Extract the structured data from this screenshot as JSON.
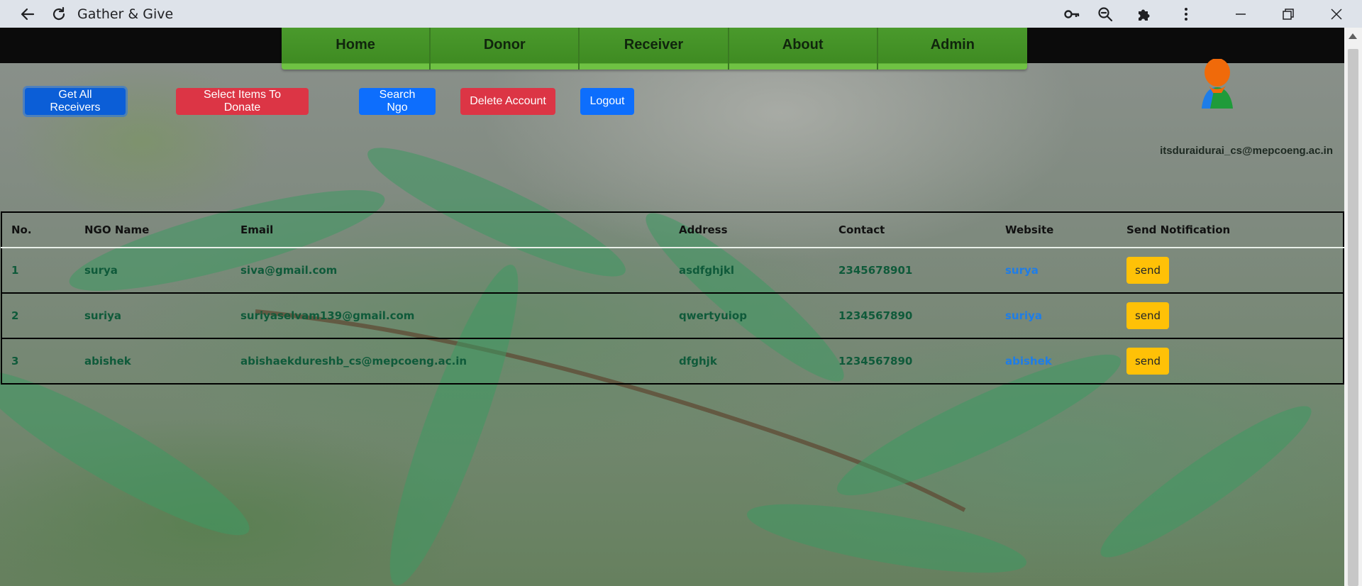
{
  "browser": {
    "title": "Gather & Give",
    "icons": [
      "back-icon",
      "reload-icon",
      "key-icon",
      "zoom-out-icon",
      "extensions-icon",
      "more-icon",
      "minimize-icon",
      "restore-icon",
      "close-icon"
    ]
  },
  "nav": {
    "items": [
      "Home",
      "Donor",
      "Receiver",
      "About",
      "Admin"
    ]
  },
  "actions": {
    "get_all_receivers": "Get All Receivers",
    "select_items": "Select Items To Donate",
    "search_ngo": "Search Ngo",
    "delete_account": "Delete Account",
    "logout": "Logout"
  },
  "user": {
    "email": "itsduraidurai_cs@mepcoeng.ac.in"
  },
  "table": {
    "headers": {
      "no": "No.",
      "name": "NGO Name",
      "email": "Email",
      "address": "Address",
      "contact": "Contact",
      "website": "Website",
      "notify": "Send Notification"
    },
    "rows": [
      {
        "no": "1",
        "name": "surya",
        "email": "siva@gmail.com",
        "address": "asdfghjkl",
        "contact": "2345678901",
        "website": "surya",
        "action": "send"
      },
      {
        "no": "2",
        "name": "suriya",
        "email": "suriyaselvam139@gmail.com",
        "address": "qwertyuiop",
        "contact": "1234567890",
        "website": "suriya",
        "action": "send"
      },
      {
        "no": "3",
        "name": "abishek",
        "email": "abishaekdureshb_cs@mepcoeng.ac.in",
        "address": "dfghjk",
        "contact": "1234567890",
        "website": "abishek",
        "action": "send"
      }
    ]
  },
  "colors": {
    "nav_green": "#4a9a2c",
    "primary_blue": "#0d6efd",
    "danger_red": "#dc3545",
    "warning_yellow": "#ffc107",
    "row_text_green": "#0f5a3a",
    "link_blue": "#1e7de8"
  }
}
